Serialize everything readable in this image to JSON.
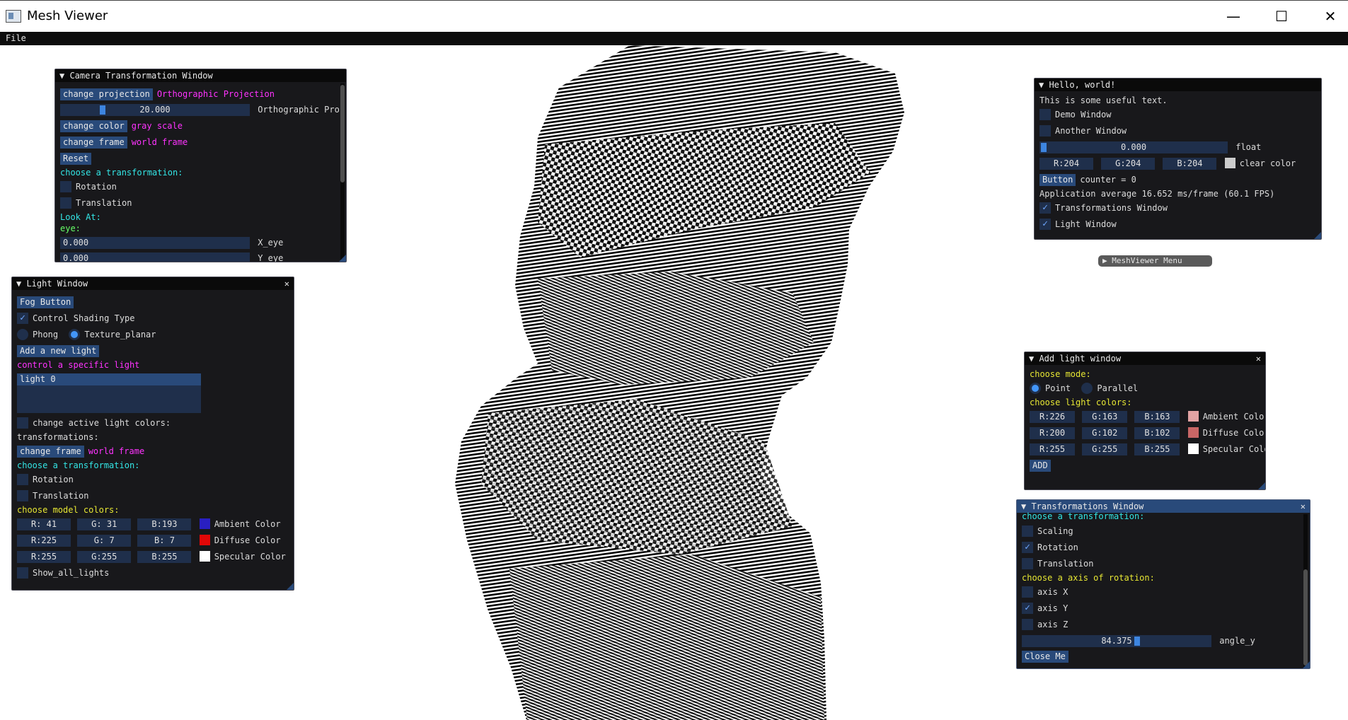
{
  "window": {
    "title": "Mesh Viewer",
    "minimize": "—",
    "maximize": "☐",
    "close": "✕"
  },
  "menubar": {
    "file": "File"
  },
  "camera": {
    "title": "▼ Camera Transformation Window",
    "projection_button": "change projection",
    "projection_value": "Orthographic Projection",
    "slider_value": "20.000",
    "slider_fraction": 0.21,
    "slider_label": "Orthographic Pro.",
    "color_button": "change color",
    "color_value": "gray scale",
    "frame_button": "change frame",
    "frame_value": "world frame",
    "reset_button": "Reset",
    "choose_label": "choose a transformation:",
    "rotation": "Rotation",
    "translation": "Translation",
    "look_at": "Look At:",
    "eye": "eye:",
    "x_eye_value": "0.000",
    "x_eye_label": "X_eye",
    "y_eye_value": "0.000",
    "y_eye_label": "Y_eye"
  },
  "light": {
    "title": "▼ Light Window",
    "close": "✕",
    "fog_button": "Fog Button",
    "shading_label": "Control Shading Type",
    "phong": "Phong",
    "texture": "Texture_planar",
    "add_light_button": "Add a new light",
    "control_label": "control a specific light",
    "light_item": "light 0",
    "active_colors": "change active light colors:",
    "transformations": "transformations:",
    "frame_button": "change frame",
    "frame_value": "world frame",
    "choose_label": "choose a transformation:",
    "rotation": "Rotation",
    "translation": "Translation",
    "model_colors": "choose model colors:",
    "ambient": {
      "r": "R: 41",
      "g": "G: 31",
      "b": "B:193",
      "label": "Ambient Color",
      "color": "#291fc1"
    },
    "diffuse": {
      "r": "R:225",
      "g": "G:  7",
      "b": "B:  7",
      "label": "Diffuse Color",
      "color": "#e10707"
    },
    "specular": {
      "r": "R:255",
      "g": "G:255",
      "b": "B:255",
      "label": "Specular Color",
      "color": "#ffffff"
    },
    "show_all": "Show_all_lights"
  },
  "hello": {
    "title": "▼ Hello, world!",
    "text": "This is some useful text.",
    "demo": "Demo Window",
    "another": "Another Window",
    "float_value": "0.000",
    "float_fraction": 0.0,
    "float_label": "float",
    "r": "R:204",
    "g": "G:204",
    "b": "B:204",
    "clear_label": "clear color",
    "clear_color": "#cccccc",
    "button": "Button",
    "counter": "counter = 0",
    "average": "Application average 16.652 ms/frame (60.1 FPS)",
    "transformations_window": "Transformations Window",
    "light_window": "Light Window"
  },
  "meshviewer_menu": "▶ MeshViewer Menu",
  "addlight": {
    "title": "▼ Add light window",
    "close": "✕",
    "mode_label": "choose mode:",
    "point": "Point",
    "parallel": "Parallel",
    "colors_label": "choose light colors:",
    "ambient": {
      "r": "R:226",
      "g": "G:163",
      "b": "B:163",
      "label": "Ambient Color",
      "color": "#e2a3a3"
    },
    "diffuse": {
      "r": "R:200",
      "g": "G:102",
      "b": "B:102",
      "label": "Diffuse Color",
      "color": "#c86666"
    },
    "specular": {
      "r": "R:255",
      "g": "G:255",
      "b": "B:255",
      "label": "Specular Color",
      "color": "#ffffff"
    },
    "add_button": "ADD"
  },
  "transforms": {
    "title": "▼ Transformations Window",
    "close": "✕",
    "choose_label": "choose a transformation:",
    "scaling": "Scaling",
    "rotation": "Rotation",
    "translation": "Translation",
    "axis_label": "choose a axis of rotation:",
    "axis_x": "axis X",
    "axis_y": "axis Y",
    "axis_z": "axis Z",
    "angle_value": "84.375",
    "angle_fraction": 0.615,
    "angle_label": "angle_y",
    "close_button": "Close Me"
  }
}
